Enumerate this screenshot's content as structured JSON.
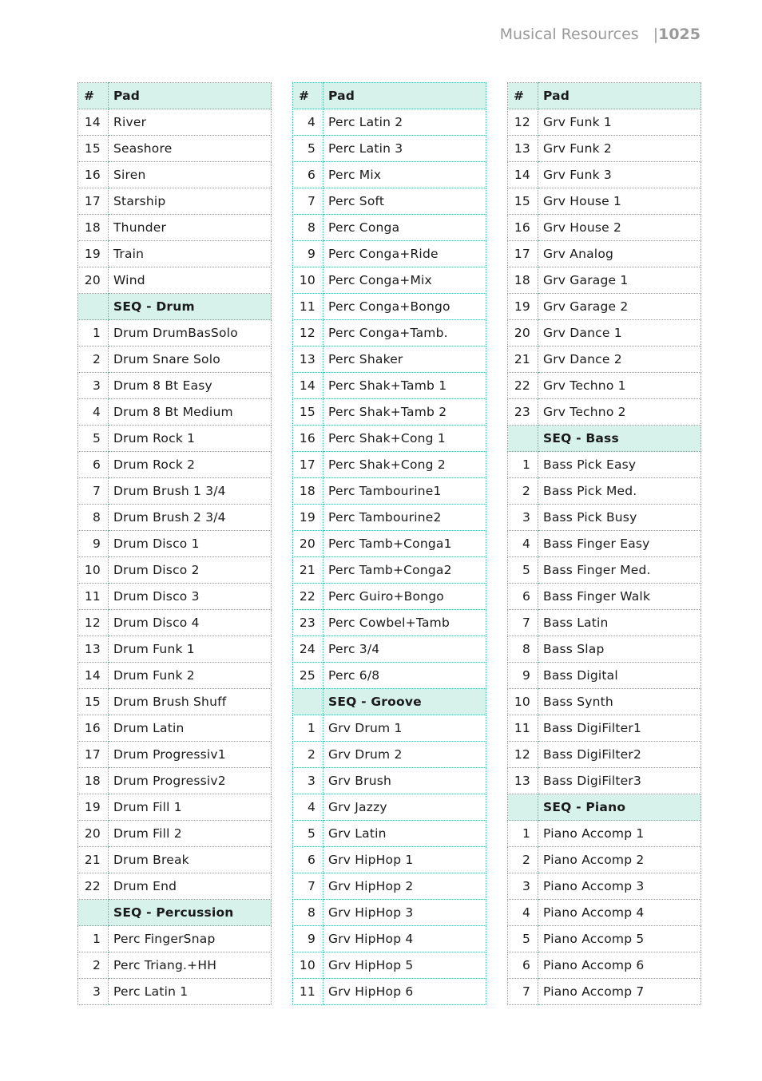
{
  "page_header": {
    "section": "Musical Resources",
    "separator": "|",
    "page_number": "1025"
  },
  "columns": {
    "num": "#",
    "name": "Pad"
  },
  "tables": [
    {
      "rows": [
        {
          "num": "14",
          "name": "River"
        },
        {
          "num": "15",
          "name": "Seashore"
        },
        {
          "num": "16",
          "name": "Siren"
        },
        {
          "num": "17",
          "name": "Starship"
        },
        {
          "num": "18",
          "name": "Thunder"
        },
        {
          "num": "19",
          "name": "Train"
        },
        {
          "num": "20",
          "name": "Wind"
        },
        {
          "num": "",
          "name": "SEQ - Drum",
          "section": true
        },
        {
          "num": "1",
          "name": "Drum DrumBasSolo"
        },
        {
          "num": "2",
          "name": "Drum Snare Solo"
        },
        {
          "num": "3",
          "name": "Drum 8 Bt Easy"
        },
        {
          "num": "4",
          "name": "Drum 8 Bt Medium"
        },
        {
          "num": "5",
          "name": "Drum Rock 1"
        },
        {
          "num": "6",
          "name": "Drum Rock 2"
        },
        {
          "num": "7",
          "name": "Drum Brush 1 3/4"
        },
        {
          "num": "8",
          "name": "Drum Brush 2 3/4"
        },
        {
          "num": "9",
          "name": "Drum Disco 1"
        },
        {
          "num": "10",
          "name": "Drum Disco 2"
        },
        {
          "num": "11",
          "name": "Drum Disco 3"
        },
        {
          "num": "12",
          "name": "Drum Disco 4"
        },
        {
          "num": "13",
          "name": "Drum Funk 1"
        },
        {
          "num": "14",
          "name": "Drum Funk 2"
        },
        {
          "num": "15",
          "name": "Drum Brush Shuff"
        },
        {
          "num": "16",
          "name": "Drum Latin"
        },
        {
          "num": "17",
          "name": "Drum Progressiv1"
        },
        {
          "num": "18",
          "name": "Drum Progressiv2"
        },
        {
          "num": "19",
          "name": "Drum Fill 1"
        },
        {
          "num": "20",
          "name": "Drum Fill 2"
        },
        {
          "num": "21",
          "name": "Drum Break"
        },
        {
          "num": "22",
          "name": "Drum End"
        },
        {
          "num": "",
          "name": "SEQ - Percussion",
          "section": true
        },
        {
          "num": "1",
          "name": "Perc FingerSnap"
        },
        {
          "num": "2",
          "name": "Perc Triang.+HH"
        },
        {
          "num": "3",
          "name": "Perc Latin 1"
        }
      ]
    },
    {
      "rows": [
        {
          "num": "4",
          "name": "Perc Latin 2"
        },
        {
          "num": "5",
          "name": "Perc Latin 3"
        },
        {
          "num": "6",
          "name": "Perc Mix"
        },
        {
          "num": "7",
          "name": "Perc Soft"
        },
        {
          "num": "8",
          "name": "Perc Conga"
        },
        {
          "num": "9",
          "name": "Perc Conga+Ride"
        },
        {
          "num": "10",
          "name": "Perc Conga+Mix"
        },
        {
          "num": "11",
          "name": "Perc Conga+Bongo"
        },
        {
          "num": "12",
          "name": "Perc Conga+Tamb."
        },
        {
          "num": "13",
          "name": "Perc Shaker"
        },
        {
          "num": "14",
          "name": "Perc Shak+Tamb 1"
        },
        {
          "num": "15",
          "name": "Perc Shak+Tamb 2"
        },
        {
          "num": "16",
          "name": "Perc Shak+Cong 1"
        },
        {
          "num": "17",
          "name": "Perc Shak+Cong 2"
        },
        {
          "num": "18",
          "name": "Perc Tambourine1"
        },
        {
          "num": "19",
          "name": "Perc Tambourine2"
        },
        {
          "num": "20",
          "name": "Perc Tamb+Conga1"
        },
        {
          "num": "21",
          "name": "Perc Tamb+Conga2"
        },
        {
          "num": "22",
          "name": "Perc Guiro+Bongo"
        },
        {
          "num": "23",
          "name": "Perc Cowbel+Tamb"
        },
        {
          "num": "24",
          "name": "Perc 3/4"
        },
        {
          "num": "25",
          "name": "Perc 6/8"
        },
        {
          "num": "",
          "name": "SEQ - Groove",
          "section": true
        },
        {
          "num": "1",
          "name": "Grv Drum 1"
        },
        {
          "num": "2",
          "name": "Grv Drum 2"
        },
        {
          "num": "3",
          "name": "Grv Brush"
        },
        {
          "num": "4",
          "name": "Grv Jazzy"
        },
        {
          "num": "5",
          "name": "Grv Latin"
        },
        {
          "num": "6",
          "name": "Grv HipHop 1"
        },
        {
          "num": "7",
          "name": "Grv HipHop 2"
        },
        {
          "num": "8",
          "name": "Grv HipHop 3"
        },
        {
          "num": "9",
          "name": "Grv HipHop 4"
        },
        {
          "num": "10",
          "name": "Grv HipHop 5"
        },
        {
          "num": "11",
          "name": "Grv HipHop 6"
        }
      ]
    },
    {
      "rows": [
        {
          "num": "12",
          "name": "Grv Funk 1"
        },
        {
          "num": "13",
          "name": "Grv Funk 2"
        },
        {
          "num": "14",
          "name": "Grv Funk 3"
        },
        {
          "num": "15",
          "name": "Grv House 1"
        },
        {
          "num": "16",
          "name": "Grv House 2"
        },
        {
          "num": "17",
          "name": "Grv Analog"
        },
        {
          "num": "18",
          "name": "Grv Garage 1"
        },
        {
          "num": "19",
          "name": "Grv Garage 2"
        },
        {
          "num": "20",
          "name": "Grv Dance 1"
        },
        {
          "num": "21",
          "name": "Grv Dance 2"
        },
        {
          "num": "22",
          "name": "Grv Techno 1"
        },
        {
          "num": "23",
          "name": "Grv Techno 2"
        },
        {
          "num": "",
          "name": "SEQ - Bass",
          "section": true
        },
        {
          "num": "1",
          "name": "Bass Pick Easy"
        },
        {
          "num": "2",
          "name": "Bass Pick Med."
        },
        {
          "num": "3",
          "name": "Bass Pick Busy"
        },
        {
          "num": "4",
          "name": "Bass Finger Easy"
        },
        {
          "num": "5",
          "name": "Bass Finger Med."
        },
        {
          "num": "6",
          "name": "Bass Finger Walk"
        },
        {
          "num": "7",
          "name": "Bass Latin"
        },
        {
          "num": "8",
          "name": "Bass Slap"
        },
        {
          "num": "9",
          "name": "Bass Digital"
        },
        {
          "num": "10",
          "name": "Bass Synth"
        },
        {
          "num": "11",
          "name": "Bass DigiFilter1"
        },
        {
          "num": "12",
          "name": "Bass DigiFilter2"
        },
        {
          "num": "13",
          "name": "Bass DigiFilter3"
        },
        {
          "num": "",
          "name": "SEQ - Piano",
          "section": true
        },
        {
          "num": "1",
          "name": "Piano Accomp 1"
        },
        {
          "num": "2",
          "name": "Piano Accomp 2"
        },
        {
          "num": "3",
          "name": "Piano Accomp 3"
        },
        {
          "num": "4",
          "name": "Piano Accomp 4"
        },
        {
          "num": "5",
          "name": "Piano Accomp 5"
        },
        {
          "num": "6",
          "name": "Piano Accomp 6"
        },
        {
          "num": "7",
          "name": "Piano Accomp 7"
        }
      ]
    }
  ]
}
